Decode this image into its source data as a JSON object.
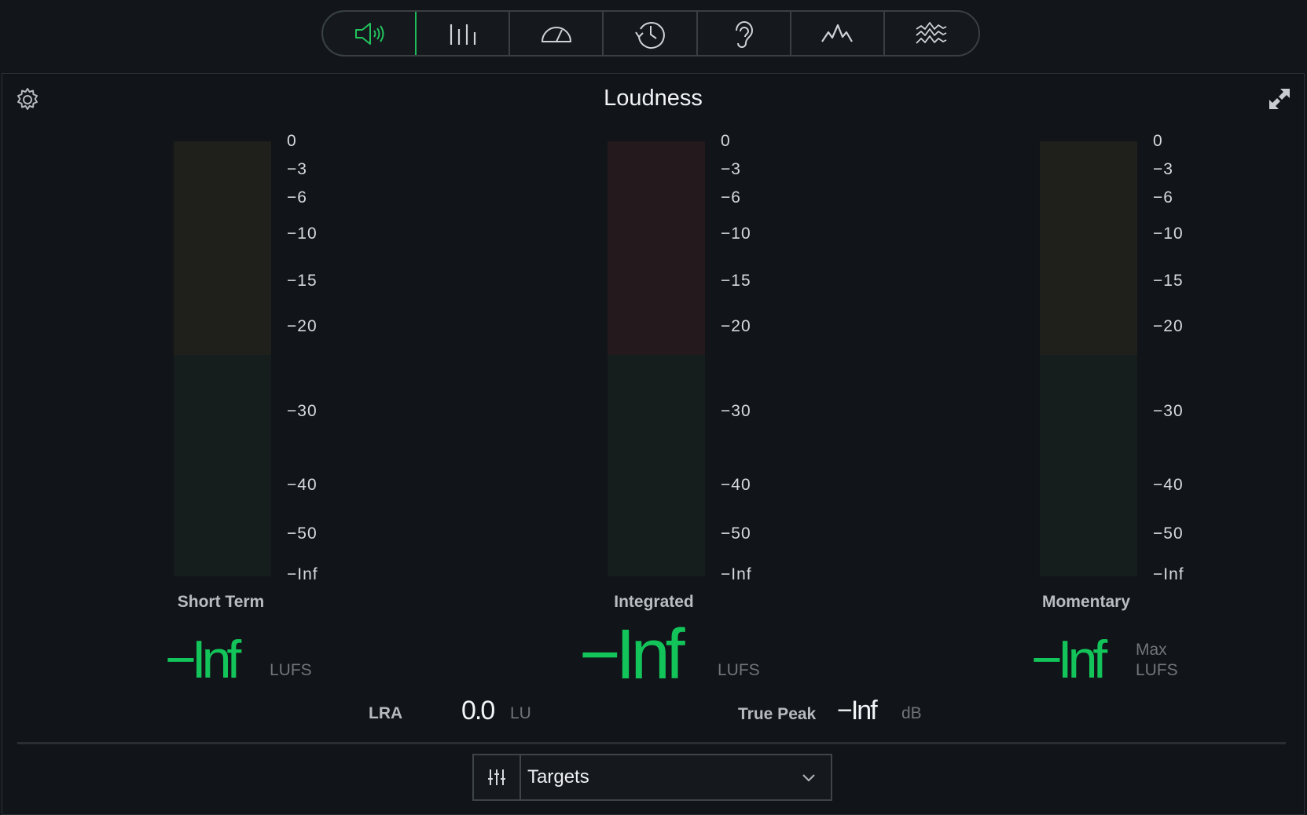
{
  "tabs": [
    {
      "icon": "speaker-icon",
      "active": true
    },
    {
      "icon": "bars-icon",
      "active": false
    },
    {
      "icon": "gauge-icon",
      "active": false
    },
    {
      "icon": "history-icon",
      "active": false
    },
    {
      "icon": "ear-icon",
      "active": false
    },
    {
      "icon": "waveform-icon",
      "active": false
    },
    {
      "icon": "spectrogram-icon",
      "active": false
    }
  ],
  "panel": {
    "title": "Loudness"
  },
  "scale_ticks": [
    "0",
    "−3",
    "−6",
    "−10",
    "−15",
    "−20",
    "−30",
    "−40",
    "−50",
    "−Inf"
  ],
  "meters": {
    "short_term": {
      "label": "Short Term",
      "value": "−Inf",
      "unit": "LUFS",
      "upper_color": "#1f201b"
    },
    "integrated": {
      "label": "Integrated",
      "value": "−Inf",
      "unit": "LUFS",
      "upper_color": "#241a1d"
    },
    "momentary": {
      "label": "Momentary",
      "value": "−Inf",
      "unit_line1": "Max",
      "unit_line2": "LUFS",
      "upper_color": "#1f201b"
    }
  },
  "stats": {
    "lra": {
      "label": "LRA",
      "value": "0.0",
      "unit": "LU"
    },
    "true_peak": {
      "label": "True Peak",
      "value": "−Inf",
      "unit": "dB"
    }
  },
  "targets": {
    "label": "Targets"
  },
  "colors": {
    "accent": "#12c45a",
    "tab_active_border": "#1fbb5a"
  }
}
